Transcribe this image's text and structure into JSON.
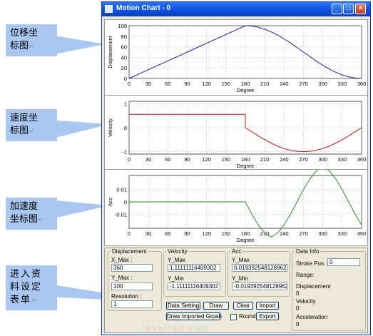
{
  "callouts": {
    "displacement_chart": {
      "line1": "位移坐",
      "line2": "标图"
    },
    "velocity_chart": {
      "line1": "速度坐",
      "line2": "标图"
    },
    "acc_chart": {
      "line1": "加速度",
      "line2": "坐标图"
    },
    "data_setting": {
      "line1": "进入资",
      "line2": "料设定",
      "line3": "表单"
    },
    "paragraph_mark": "↵"
  },
  "window": {
    "title": "Motion Chart - 0"
  },
  "colors": {
    "displacement": "#1a1aa0",
    "velocity": "#b01818",
    "acceleration": "#2d8a2d",
    "grid": "#9c9c9c"
  },
  "chart_data": [
    {
      "type": "line",
      "ylabel": "Displacement",
      "xlabel": "Degree",
      "xlim": [
        0,
        360
      ],
      "ylim": [
        0,
        100
      ],
      "xticks": [
        0,
        30,
        60,
        90,
        120,
        150,
        180,
        210,
        240,
        270,
        300,
        330,
        360
      ],
      "yticks": [
        0,
        20,
        40,
        60,
        80,
        100
      ],
      "x": [
        0,
        30,
        60,
        90,
        120,
        150,
        180,
        190,
        200,
        210,
        220,
        230,
        240,
        250,
        260,
        270,
        280,
        290,
        300,
        310,
        320,
        330,
        340,
        350,
        360
      ],
      "y": [
        0,
        16.7,
        33.3,
        50,
        66.7,
        83.3,
        100,
        99.3,
        97.0,
        93.3,
        88.3,
        82.1,
        75.0,
        67.1,
        58.7,
        50.0,
        41.3,
        32.9,
        25.0,
        17.9,
        11.7,
        6.7,
        3.0,
        0.8,
        0
      ]
    },
    {
      "type": "line",
      "ylabel": "Velocity",
      "xlabel": "Degree",
      "xlim": [
        0,
        360
      ],
      "ylim": [
        -1.1,
        1.1
      ],
      "xticks": [
        0,
        30,
        60,
        90,
        120,
        150,
        180,
        210,
        240,
        270,
        300,
        330,
        360
      ],
      "yticks": [
        -1,
        0,
        1
      ],
      "x": [
        0,
        180,
        180,
        190,
        200,
        210,
        220,
        230,
        240,
        250,
        260,
        270,
        280,
        290,
        300,
        310,
        320,
        330,
        340,
        350,
        360
      ],
      "y": [
        0.56,
        0.56,
        0,
        -0.17,
        -0.34,
        -0.5,
        -0.64,
        -0.77,
        -0.87,
        -0.94,
        -0.98,
        -1.0,
        -0.98,
        -0.94,
        -0.87,
        -0.77,
        -0.64,
        -0.5,
        -0.34,
        -0.17,
        0
      ]
    },
    {
      "type": "line",
      "ylabel": "Acc",
      "xlabel": "Degree",
      "xlim": [
        0,
        360
      ],
      "ylim": [
        -0.021,
        0.021
      ],
      "xticks": [
        0,
        30,
        60,
        90,
        120,
        150,
        180,
        210,
        240,
        270,
        300,
        330,
        360
      ],
      "yticks": [
        -0.01,
        0,
        0.01
      ],
      "x": [
        0,
        180,
        190,
        200,
        210,
        220,
        230,
        240,
        250,
        260,
        270,
        280,
        290,
        300,
        310,
        320,
        330,
        340,
        350,
        360
      ],
      "y": [
        0,
        0,
        -0.0097,
        -0.0183,
        -0.0247,
        -0.028,
        -0.0247,
        -0.0183,
        -0.0097,
        0,
        0.0097,
        0.0183,
        0.0247,
        0.028,
        0.0247,
        0.0183,
        0.0097,
        0,
        -0.0097,
        -0.0183
      ]
    }
  ],
  "displacement_group": {
    "legend": "Displacement",
    "xmax_label": "X_Max :",
    "xmax_value": "360",
    "ymax_label": "Y_Max :",
    "ymax_value": "100",
    "resolution_label": "Resolution :",
    "resolution_value": "1"
  },
  "velocity_group": {
    "legend": "Velocity",
    "ymax_label": "Y_Max",
    "ymax_value": "1.11111116409302",
    "ymin_label": "Y_Min",
    "ymin_value": "-1.11111116409302"
  },
  "acc_group": {
    "legend": "Acc",
    "ymax_label": "Y_Max",
    "ymax_value": "0.0193925481289625",
    "ymin_label": "Y_Min",
    "ymin_value": "-0.0193925481289625"
  },
  "data_info": {
    "legend": "Data Info",
    "stroke_label": "Stroke Pos :",
    "stroke_value": "0",
    "range_label": "Range:",
    "displacement_label": "Displacement",
    "displacement_value": "0",
    "velocity_label": "Velocity",
    "velocity_value": "0",
    "acceleration_label": "Acceleration",
    "acceleration_value": "0"
  },
  "buttons": {
    "data_setting": "Data Setting",
    "draw": "Draw",
    "clear": "Clear",
    "import": "Import",
    "draw_imported": "Draw Imported Grpah",
    "round": "Round",
    "export": "Export"
  },
  "watermark": "laserfair.com"
}
